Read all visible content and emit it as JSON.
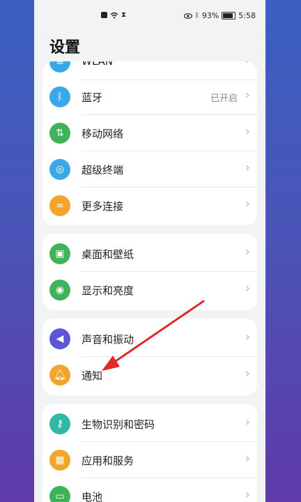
{
  "status_bar": {
    "battery_percent": "93%",
    "time": "5:58"
  },
  "title": "设置",
  "groups": [
    {
      "items": [
        {
          "label": "WLAN",
          "value": "",
          "icon": "wifi-icon",
          "color": "#3aa7e8"
        },
        {
          "label": "蓝牙",
          "value": "已开启",
          "icon": "bluetooth-icon",
          "color": "#3aa7e8"
        },
        {
          "label": "移动网络",
          "value": "",
          "icon": "mobile-data-icon",
          "color": "#3fb25a"
        },
        {
          "label": "超级终端",
          "value": "",
          "icon": "super-device-icon",
          "color": "#3aa7e8"
        },
        {
          "label": "更多连接",
          "value": "",
          "icon": "link-icon",
          "color": "#f2a42c"
        }
      ]
    },
    {
      "items": [
        {
          "label": "桌面和壁纸",
          "value": "",
          "icon": "wallpaper-icon",
          "color": "#3fb25a"
        },
        {
          "label": "显示和亮度",
          "value": "",
          "icon": "eye-icon",
          "color": "#3fb25a"
        }
      ]
    },
    {
      "items": [
        {
          "label": "声音和振动",
          "value": "",
          "icon": "speaker-icon",
          "color": "#5b56d9"
        },
        {
          "label": "通知",
          "value": "",
          "icon": "bell-icon",
          "color": "#f2a42c"
        }
      ]
    },
    {
      "items": [
        {
          "label": "生物识别和密码",
          "value": "",
          "icon": "key-icon",
          "color": "#2fb8a8"
        },
        {
          "label": "应用和服务",
          "value": "",
          "icon": "apps-icon",
          "color": "#f2a42c"
        },
        {
          "label": "电池",
          "value": "",
          "icon": "battery-icon",
          "color": "#3fb25a"
        }
      ]
    }
  ],
  "annotation": {
    "icon": "red-arrow-icon",
    "color": "#e02a2a"
  },
  "chevron": "›"
}
